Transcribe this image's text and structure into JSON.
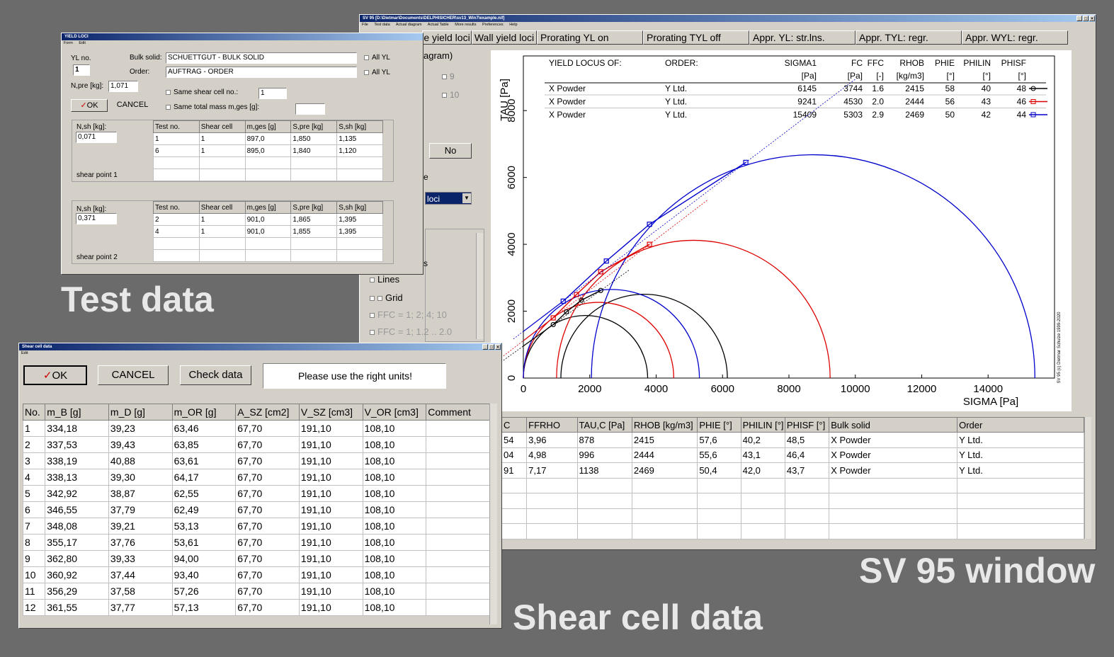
{
  "captions": {
    "test_data": "Test data",
    "sv95_window": "SV 95 window",
    "shear_cell_data": "Shear cell data"
  },
  "sv95": {
    "title": "SV 95  [D:\\Dietmar\\Documents\\DELPHISICHER\\sv13_Win7\\example.nif]",
    "menu": [
      "File",
      "Test data",
      "Actual diagram",
      "Actual Table",
      "More results",
      "Preferences",
      "Help"
    ],
    "toolbar": [
      "e yield loci",
      "Wall yield loci",
      "Prorating YL on",
      "Prorating TYL off",
      "Appr. YL: str.lns.",
      "Appr. TYL: regr.",
      "Appr. WYL: regr."
    ],
    "left_panel": {
      "agram": "agram)",
      "opt9": "9",
      "opt10": "10",
      "no_button": "No",
      "e_label": "e",
      "loci_select": "loci",
      "s_label": "s",
      "lines": "Lines",
      "grid": "Grid",
      "ffc1": "FFC = 1; 2; 4; 10",
      "ffc2": "FFC = 1; 1.2 .. 2.0"
    },
    "table": {
      "headers": [
        "C",
        "FFRHO",
        "TAU,C [Pa]",
        "RHOB [kg/m3]",
        "PHIE [°]",
        "PHILIN [°]",
        "PHISF [°]",
        "Bulk solid",
        "Order"
      ],
      "rows": [
        [
          "54",
          "3,96",
          "878",
          "2415",
          "57,6",
          "40,2",
          "48,5",
          "X Powder",
          "Y Ltd."
        ],
        [
          "04",
          "4,98",
          "996",
          "2444",
          "55,6",
          "43,1",
          "46,4",
          "X Powder",
          "Y Ltd."
        ],
        [
          "91",
          "7,17",
          "1138",
          "2469",
          "50,4",
          "42,0",
          "43,7",
          "X Powder",
          "Y Ltd."
        ]
      ]
    }
  },
  "chart_data": {
    "type": "scatter",
    "title": "",
    "xlabel": "SIGMA [Pa]",
    "ylabel": "TAU [Pa]",
    "xlim": [
      0,
      16000
    ],
    "ylim": [
      0,
      9000
    ],
    "xticks": [
      "0",
      "2000",
      "4000",
      "6000",
      "8000",
      "10000",
      "12000",
      "14000"
    ],
    "yticks": [
      "0",
      "2000",
      "4000",
      "6000",
      "8000"
    ],
    "copyright": "SV 95 (c) Dietmar Schulze 1999-2020",
    "legend_headers": [
      "YIELD LOCUS OF:",
      "ORDER:",
      "SIGMA1",
      "FC",
      "FFC",
      "RHOB",
      "PHIE",
      "PHILIN",
      "PHISF"
    ],
    "legend_units": [
      "",
      "",
      "[Pa]",
      "[Pa]",
      "[-]",
      "[kg/m3]",
      "[°]",
      "[°]",
      "[°]"
    ],
    "series": [
      {
        "name": "X Powder",
        "order": "Y Ltd.",
        "sigma1": "6145",
        "fc": "3744",
        "ffc": "1.6",
        "rhob": "2415",
        "phie": "58",
        "philin": "40",
        "phisf": "48",
        "color": "#000000",
        "marker": "circle",
        "points": [
          [
            900,
            1600
          ],
          [
            1300,
            1980
          ],
          [
            1750,
            2330
          ],
          [
            2330,
            2620
          ]
        ],
        "fc_circle": [
          0,
          3744
        ],
        "major_circle": [
          1130,
          6145
        ],
        "tangent_pt": [
          2350,
          2850
        ]
      },
      {
        "name": "X Powder",
        "order": "Y Ltd.",
        "sigma1": "9241",
        "fc": "4530",
        "ffc": "2.0",
        "rhob": "2444",
        "phie": "56",
        "philin": "43",
        "phisf": "46",
        "color": "#dd0000",
        "marker": "square",
        "points": [
          [
            900,
            1800
          ],
          [
            1600,
            2500
          ],
          [
            2330,
            3180
          ],
          [
            3800,
            4000
          ]
        ],
        "fc_circle": [
          0,
          4530
        ],
        "major_circle": [
          1000,
          9241
        ]
      },
      {
        "name": "X Powder",
        "order": "Y Ltd.",
        "sigma1": "15409",
        "fc": "5303",
        "ffc": "2.9",
        "rhob": "2469",
        "phie": "50",
        "philin": "42",
        "phisf": "44",
        "color": "#0000cc",
        "marker": "square",
        "points": [
          [
            1200,
            2300
          ],
          [
            2500,
            3500
          ],
          [
            3800,
            4600
          ],
          [
            6700,
            6450
          ]
        ],
        "fc_circle": [
          0,
          5303
        ],
        "major_circle": [
          2050,
          15409
        ]
      }
    ]
  },
  "yield_loci_dialog": {
    "title": "YIELD LOCI",
    "menu": [
      "Form",
      "Edit"
    ],
    "yl_no_label": "YL no.",
    "yl_no": "1",
    "bulk_solid_label": "Bulk solid:",
    "bulk_solid": "SCHUETTGUT -  BULK SOLID",
    "order_label": "Order:",
    "order": "AUFTRAG - ORDER",
    "all_yl": "All YL",
    "npre_label": "N,pre [kg]:",
    "npre": "1,071",
    "same_shear_cell": "Same shear cell no.:",
    "shear_cell_no": "1",
    "same_total_mass": "Same total mass m,ges [g]:",
    "ok": "OK",
    "cancel": "CANCEL",
    "headers": [
      "Test no.",
      "Shear cell",
      "m,ges [g]",
      "S,pre [kg]",
      "S,sh [kg]"
    ],
    "sp1": {
      "nsh_label": "N,sh [kg]:",
      "nsh": "0,071",
      "name": "shear point 1",
      "rows": [
        [
          "1",
          "1",
          "897,0",
          "1,850",
          "1,135"
        ],
        [
          "6",
          "1",
          "895,0",
          "1,840",
          "1,120"
        ]
      ]
    },
    "sp2": {
      "nsh_label": "N,sh [kg]:",
      "nsh": "0,371",
      "name": "shear point 2",
      "rows": [
        [
          "2",
          "1",
          "901,0",
          "1,865",
          "1,395"
        ],
        [
          "4",
          "1",
          "901,0",
          "1,855",
          "1,395"
        ]
      ]
    }
  },
  "shear_dialog": {
    "title": "Shear cell data",
    "menu": [
      "Edit"
    ],
    "ok": "OK",
    "cancel": "CANCEL",
    "check": "Check data",
    "message": "Please use the right units!",
    "headers": [
      "No.",
      "m_B [g]",
      "m_D [g]",
      "m_OR [g]",
      "A_SZ [cm2]",
      "V_SZ [cm3]",
      "V_OR [cm3]",
      "Comment"
    ],
    "rows": [
      [
        "1",
        "334,18",
        "39,23",
        "63,46",
        "67,70",
        "191,10",
        "108,10",
        ""
      ],
      [
        "2",
        "337,53",
        "39,43",
        "63,85",
        "67,70",
        "191,10",
        "108,10",
        ""
      ],
      [
        "3",
        "338,19",
        "40,88",
        "63,61",
        "67,70",
        "191,10",
        "108,10",
        ""
      ],
      [
        "4",
        "338,13",
        "39,30",
        "64,17",
        "67,70",
        "191,10",
        "108,10",
        ""
      ],
      [
        "5",
        "342,92",
        "38,87",
        "62,55",
        "67,70",
        "191,10",
        "108,10",
        ""
      ],
      [
        "6",
        "346,55",
        "37,79",
        "62,49",
        "67,70",
        "191,10",
        "108,10",
        ""
      ],
      [
        "7",
        "348,08",
        "39,21",
        "53,13",
        "67,70",
        "191,10",
        "108,10",
        ""
      ],
      [
        "8",
        "355,17",
        "37,76",
        "53,61",
        "67,70",
        "191,10",
        "108,10",
        ""
      ],
      [
        "9",
        "362,80",
        "39,33",
        "94,00",
        "67,70",
        "191,10",
        "108,10",
        ""
      ],
      [
        "10",
        "360,92",
        "37,44",
        "93,40",
        "67,70",
        "191,10",
        "108,10",
        ""
      ],
      [
        "11",
        "356,29",
        "37,58",
        "57,26",
        "67,70",
        "191,10",
        "108,10",
        ""
      ],
      [
        "12",
        "361,55",
        "37,77",
        "57,13",
        "67,70",
        "191,10",
        "108,10",
        ""
      ]
    ]
  }
}
